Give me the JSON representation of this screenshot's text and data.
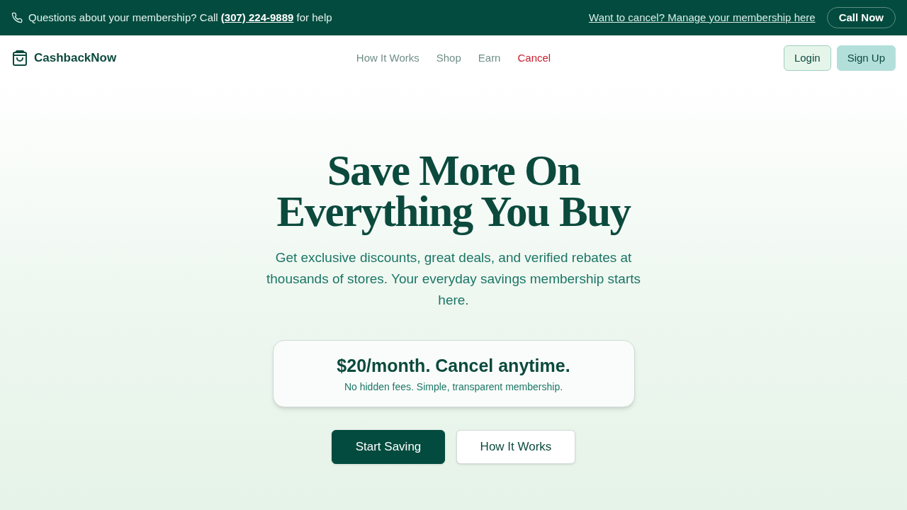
{
  "top_bar": {
    "help_text": {
      "before": "Questions about your membership? Call",
      "phone": "(307) 224-9889",
      "after": "for help"
    },
    "cancel_link": "Want to cancel? Manage your membership here",
    "call_button": "Call Now"
  },
  "nav": {
    "brand": "CashbackNow",
    "links": [
      {
        "label": "How It Works",
        "kind": "regular"
      },
      {
        "label": "Shop",
        "kind": "regular"
      },
      {
        "label": "Earn",
        "kind": "regular"
      },
      {
        "label": "Cancel",
        "kind": "alert"
      }
    ],
    "buttons": [
      {
        "label": "Login",
        "kind": "secondary"
      },
      {
        "label": "Sign Up",
        "kind": "primary"
      }
    ]
  },
  "hero": {
    "title": "Save More On Everything You Buy",
    "subtitle": "Get exclusive discounts, great deals, and verified rebates at thousands of stores. Your everyday savings membership starts here.",
    "price_card": {
      "title": "$20/month. Cancel anytime.",
      "subtitle": "No hidden fees. Simple, transparent membership."
    },
    "buttons": [
      {
        "label": "Start Saving",
        "kind": "primary"
      },
      {
        "label": "How It Works",
        "kind": "outline"
      }
    ]
  }
}
